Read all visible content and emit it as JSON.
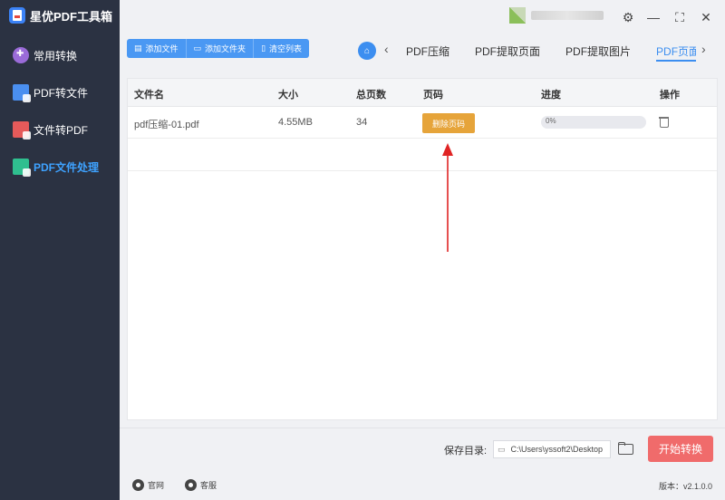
{
  "app": {
    "name": "星优PDF工具箱"
  },
  "sidebar": {
    "items": [
      {
        "label": "常用转换",
        "icon": "grid-plus-icon"
      },
      {
        "label": "PDF转文件",
        "icon": "pdf-to-file-icon"
      },
      {
        "label": "文件转PDF",
        "icon": "file-to-pdf-icon"
      },
      {
        "label": "PDF文件处理",
        "icon": "pdf-process-icon",
        "active": true
      }
    ]
  },
  "window": {
    "settings": "⚙",
    "minimize": "—",
    "maximize": "⛶",
    "close": "✕"
  },
  "toolbar": {
    "add_file": "添加文件",
    "add_folder": "添加文件夹",
    "clear_list": "清空列表"
  },
  "tabs": {
    "home_icon": "⌂",
    "prev": "‹",
    "next": "›",
    "items": [
      "PDF压缩",
      "PDF提取页面",
      "PDF提取图片",
      "PDF页面删除"
    ]
  },
  "table": {
    "headers": [
      "文件名",
      "大小",
      "总页数",
      "页码",
      "进度",
      "操作"
    ],
    "rows": [
      {
        "name": "pdf压缩-01.pdf",
        "size": "4.55MB",
        "pages": "34",
        "page_button": "删除页码",
        "progress": "0%",
        "progress_value": 0
      }
    ]
  },
  "save": {
    "label": "保存目录:",
    "path": "C:\\Users\\yssoft2\\Desktop",
    "start_button": "开始转换"
  },
  "footer": {
    "website": "官网",
    "service": "客服",
    "version": "版本：v2.1.0.0"
  },
  "colors": {
    "sidebar_bg": "#2b3242",
    "accent": "#3c8ef0",
    "delete_button": "#e6a43a",
    "start_button": "#f06b6b",
    "annotation_arrow": "#e02424"
  }
}
